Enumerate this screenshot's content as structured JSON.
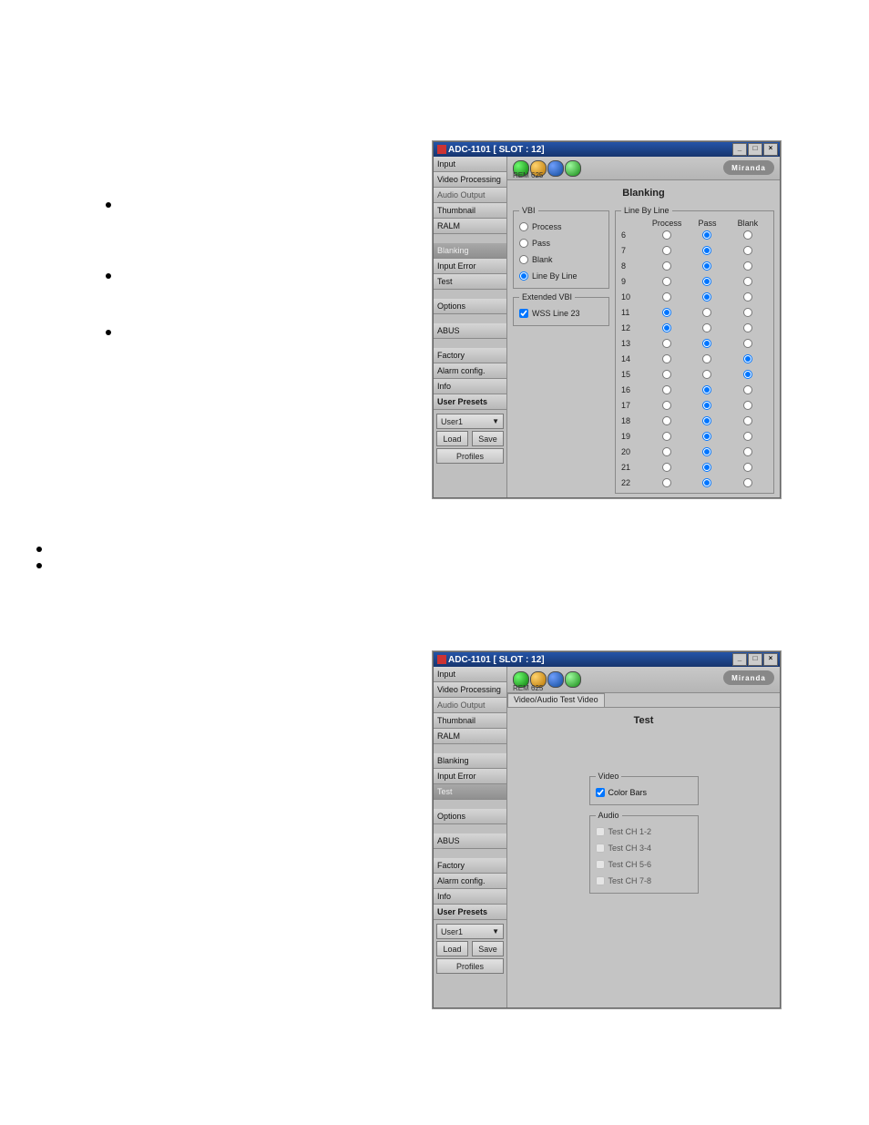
{
  "sidebar": [
    {
      "label": "Input",
      "active": false,
      "dim": false
    },
    {
      "label": "Video Processing",
      "active": false,
      "dim": false
    },
    {
      "label": "Audio Output",
      "active": false,
      "dim": true
    },
    {
      "label": "Thumbnail",
      "active": false,
      "dim": false
    },
    {
      "label": "RALM",
      "active": false,
      "dim": false
    },
    {
      "label": "",
      "spacer": true
    },
    {
      "label": "Blanking",
      "active": true,
      "dim": false
    },
    {
      "label": "Input Error",
      "active": false,
      "dim": false
    },
    {
      "label": "Test",
      "active": false,
      "dim": false
    },
    {
      "label": "",
      "spacer": true
    },
    {
      "label": "Options",
      "active": false,
      "dim": false
    },
    {
      "label": "",
      "spacer": true
    },
    {
      "label": "ABUS",
      "active": false,
      "dim": false
    },
    {
      "label": "",
      "spacer": true
    },
    {
      "label": "Factory",
      "active": false,
      "dim": false
    },
    {
      "label": "Alarm config.",
      "active": false,
      "dim": false
    },
    {
      "label": "Info",
      "active": false,
      "dim": false
    }
  ],
  "sidebar2_active_index": 8,
  "user_presets": {
    "title": "User Presets",
    "selected": "User1",
    "load": "Load",
    "save": "Save",
    "profiles": "Profiles"
  },
  "title": "ADC-1101 [ SLOT : 12]",
  "brand": "Miranda",
  "hdr_label": "REM 625",
  "win1": {
    "page_title": "Blanking",
    "vbi": {
      "legend": "VBI",
      "opts": [
        "Process",
        "Pass",
        "Blank",
        "Line By Line"
      ],
      "selected": 3
    },
    "extvbi": {
      "legend": "Extended VBI",
      "chk_label": "WSS Line 23",
      "chk": true
    },
    "lbl": {
      "legend": "Line By Line",
      "cols": [
        "Process",
        "Pass",
        "Blank"
      ],
      "rows": [
        {
          "n": "6",
          "sel": 1
        },
        {
          "n": "7",
          "sel": 1
        },
        {
          "n": "8",
          "sel": 1
        },
        {
          "n": "9",
          "sel": 1
        },
        {
          "n": "10",
          "sel": 1
        },
        {
          "n": "11",
          "sel": 0
        },
        {
          "n": "12",
          "sel": 0
        },
        {
          "n": "13",
          "sel": 1
        },
        {
          "n": "14",
          "sel": 2
        },
        {
          "n": "15",
          "sel": 2
        },
        {
          "n": "16",
          "sel": 1
        },
        {
          "n": "17",
          "sel": 1
        },
        {
          "n": "18",
          "sel": 1
        },
        {
          "n": "19",
          "sel": 1
        },
        {
          "n": "20",
          "sel": 1
        },
        {
          "n": "21",
          "sel": 1
        },
        {
          "n": "22",
          "sel": 1
        }
      ]
    }
  },
  "win2": {
    "tab": "Video/Audio Test Video",
    "page_title": "Test",
    "video": {
      "legend": "Video",
      "cb_label": "Color Bars",
      "cb": true
    },
    "audio": {
      "legend": "Audio",
      "items": [
        {
          "label": "Test CH 1-2",
          "chk": false,
          "enabled": false
        },
        {
          "label": "Test CH 3-4",
          "chk": false,
          "enabled": false
        },
        {
          "label": "Test CH 5-6",
          "chk": false,
          "enabled": false
        },
        {
          "label": "Test CH 7-8",
          "chk": false,
          "enabled": false
        }
      ]
    }
  }
}
